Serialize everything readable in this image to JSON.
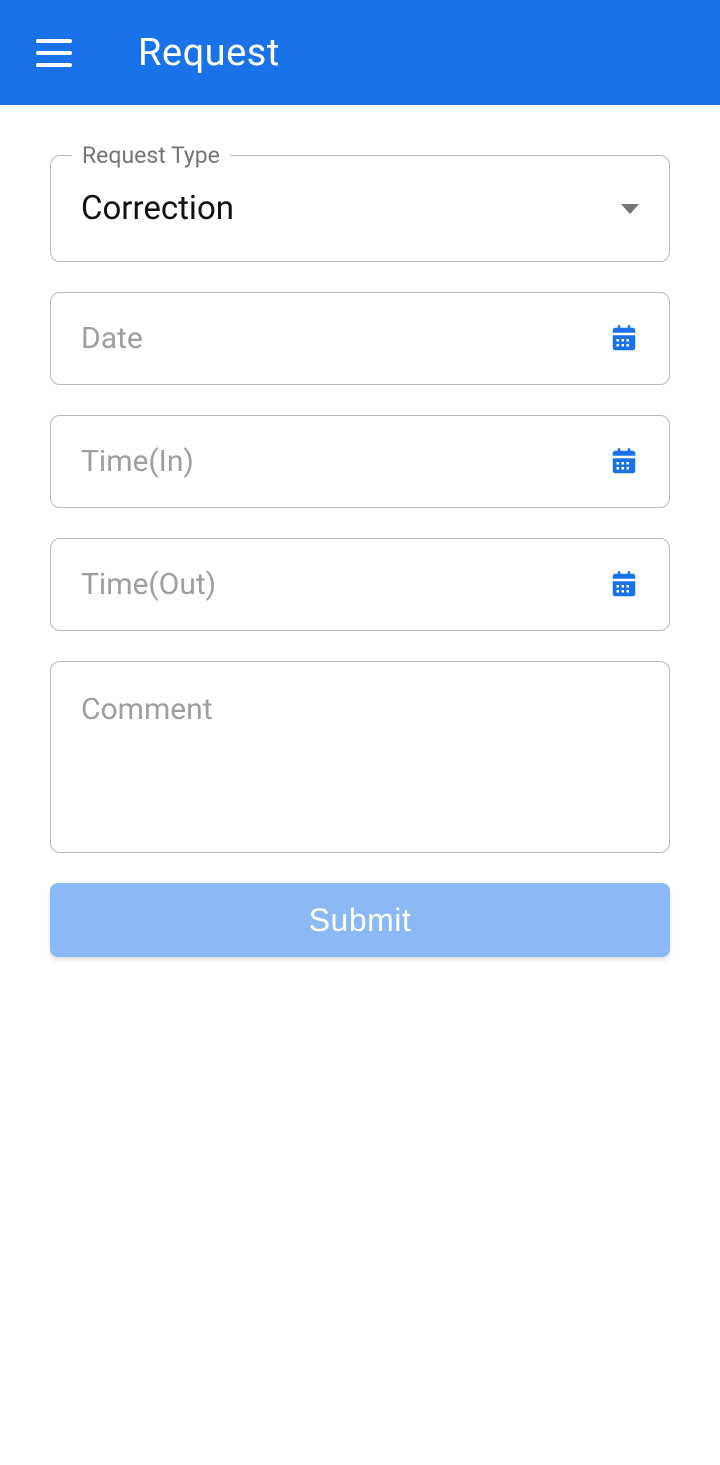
{
  "header": {
    "title": "Request"
  },
  "form": {
    "request_type": {
      "label": "Request Type",
      "value": "Correction"
    },
    "date": {
      "placeholder": "Date",
      "value": ""
    },
    "time_in": {
      "placeholder": "Time(In)",
      "value": ""
    },
    "time_out": {
      "placeholder": "Time(Out)",
      "value": ""
    },
    "comment": {
      "placeholder": "Comment",
      "value": ""
    },
    "submit_label": "Submit"
  },
  "colors": {
    "primary": "#1a72e8",
    "submit_bg": "#8ab9f5",
    "border": "#b8b8b8",
    "placeholder": "#9e9e9e",
    "label": "#757575"
  },
  "icons": {
    "hamburger": "hamburger-menu-icon",
    "dropdown": "chevron-down-icon",
    "calendar": "calendar-icon"
  }
}
